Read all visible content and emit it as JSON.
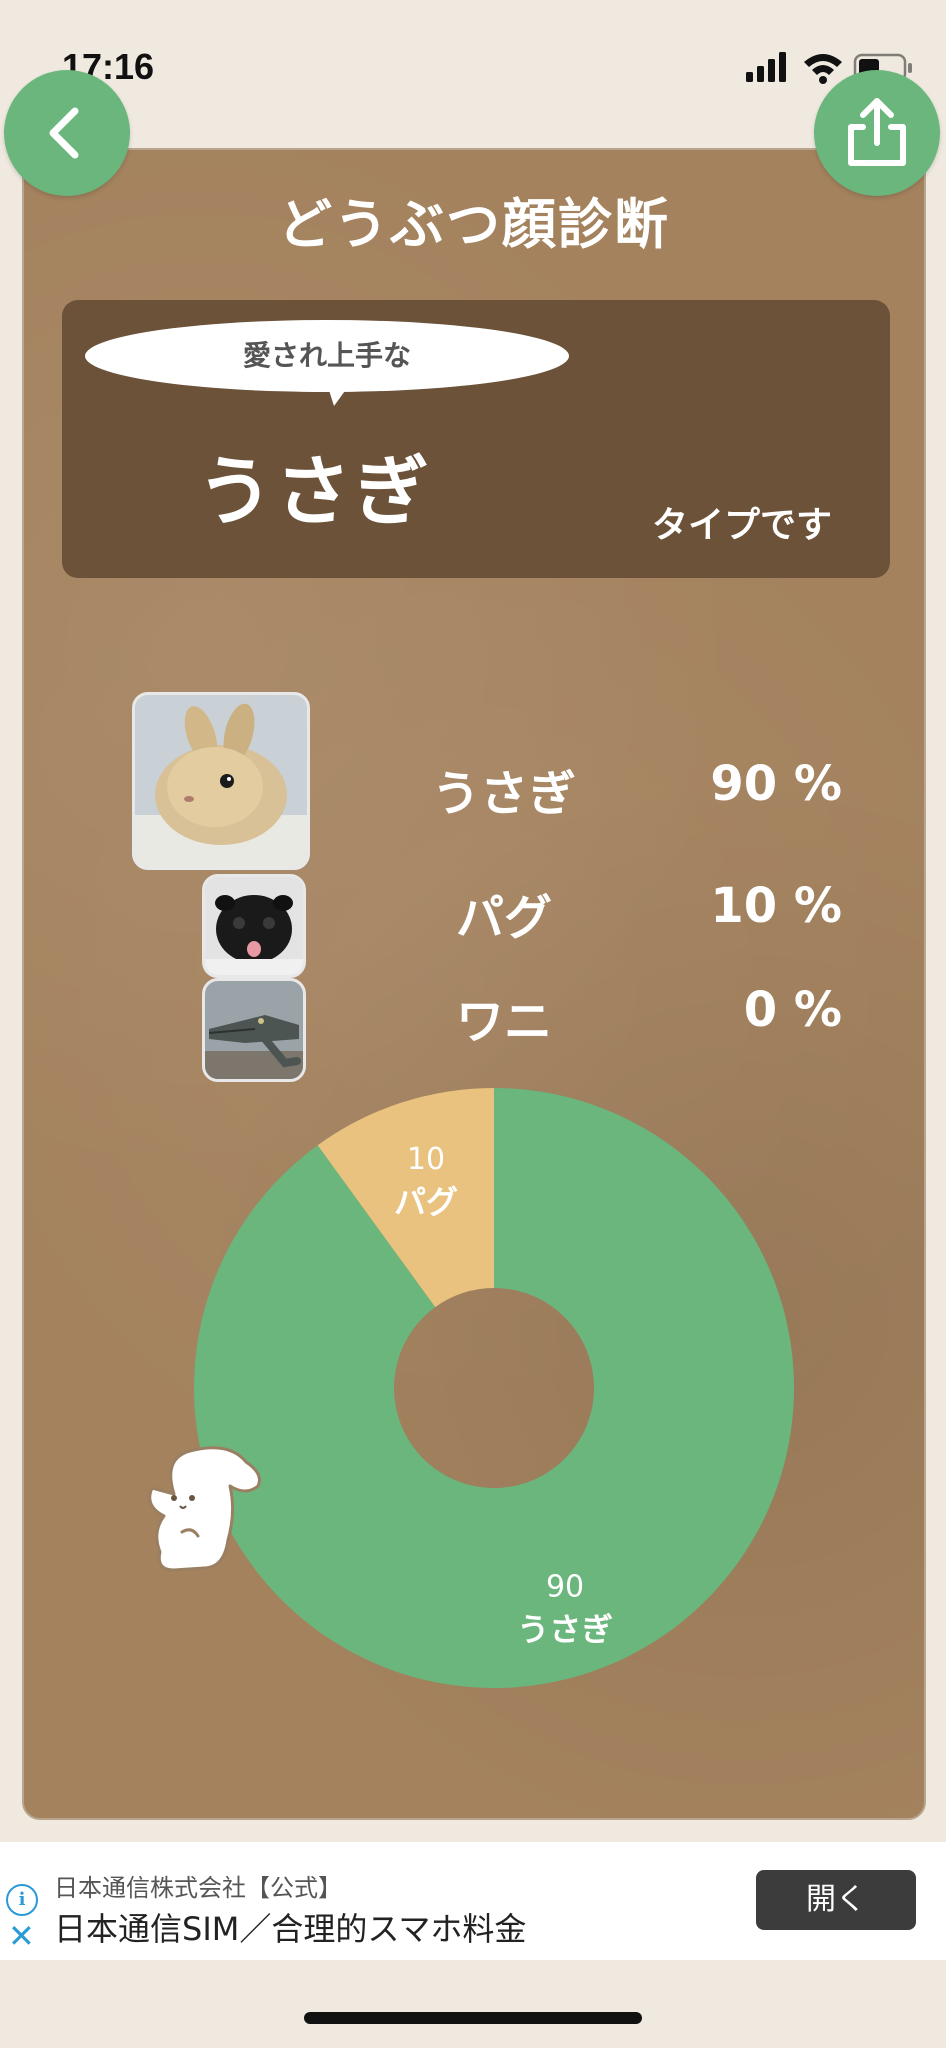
{
  "status": {
    "time": "17:16"
  },
  "header": {
    "title": "どうぶつ顔診断"
  },
  "result": {
    "bubble": "愛され上手な",
    "animal": "うさぎ",
    "suffix": "タイプです"
  },
  "rows": [
    {
      "name": "うさぎ",
      "percent": "90 %"
    },
    {
      "name": "パグ",
      "percent": "10 %"
    },
    {
      "name": "ワニ",
      "percent": "0 %"
    }
  ],
  "chart_data": {
    "type": "pie",
    "categories": [
      "うさぎ",
      "パグ"
    ],
    "values": [
      90,
      10
    ],
    "colors": [
      "#6ab67c",
      "#e8c27e"
    ],
    "labels": [
      {
        "value": "90",
        "name": "うさぎ"
      },
      {
        "value": "10",
        "name": "パグ"
      }
    ]
  },
  "ad": {
    "sponsor": "日本通信株式会社【公式】",
    "title": "日本通信SIM／合理的スマホ料金",
    "button": "開く"
  },
  "icons": {
    "back": "chevron-left-icon",
    "share": "share-icon",
    "info": "info-icon",
    "close": "close-icon"
  }
}
